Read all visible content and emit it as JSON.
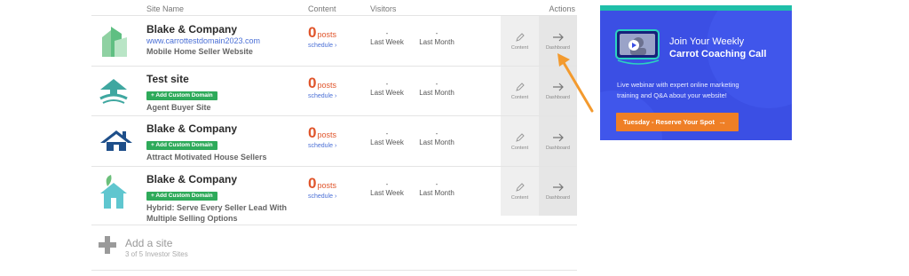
{
  "table": {
    "headers": {
      "site_name": "Site Name",
      "content": "Content",
      "visitors": "Visitors",
      "actions": "Actions"
    },
    "visitor_labels": {
      "last_week": "Last Week",
      "last_month": "Last Month"
    },
    "action_labels": {
      "content": "Content",
      "dashboard": "Dashboard"
    },
    "posts_label": "posts",
    "schedule_label": "schedule ›",
    "add_domain_label": "+ Add Custom Domain",
    "rows": [
      {
        "title": "Blake & Company",
        "url": "www.carrottestdomain2023.com",
        "type": "Mobile Home Seller Website",
        "posts": "0",
        "last_week": "-",
        "last_month": "-"
      },
      {
        "title": "Test site",
        "type": "Agent Buyer Site",
        "posts": "0",
        "last_week": "-",
        "last_month": "-"
      },
      {
        "title": "Blake & Company",
        "type": "Attract Motivated House Sellers",
        "posts": "0",
        "last_week": "-",
        "last_month": "-"
      },
      {
        "title": "Blake & Company",
        "type_line1": "Hybrid: Serve Every Seller Lead With",
        "type_line2": "Multiple Selling Options",
        "posts": "0",
        "last_week": "-",
        "last_month": "-"
      }
    ],
    "add_site": {
      "label": "Add a site",
      "count": "3 of 5 Investor Sites"
    }
  },
  "promo": {
    "title_line1": "Join Your Weekly",
    "title_line2": "Carrot Coaching Call",
    "body_line1": "Live webinar with expert online marketing",
    "body_line2": "training and Q&A about your website!",
    "button": "Tuesday - Reserve Your Spot",
    "colors": {
      "background": "#3b4fe4",
      "top_bar": "#1fbfa9",
      "button": "#ef7f26"
    }
  },
  "colors": {
    "posts": "#e0552b",
    "link": "#4a6fd6",
    "badge": "#2eaa5a",
    "pointer_arrow": "#f39a2e"
  }
}
